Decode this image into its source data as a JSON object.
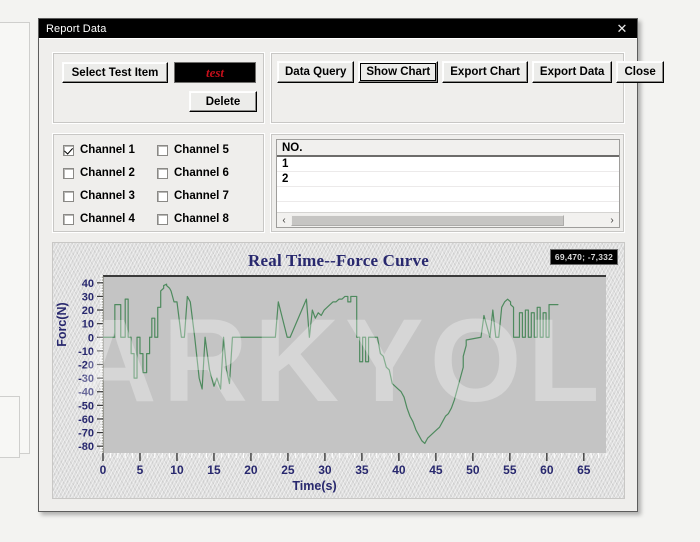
{
  "window": {
    "title": "Report Data",
    "close_icon": "close-icon",
    "close_glyph": "✕"
  },
  "test_item": {
    "select_button_label": "Select Test Item",
    "test_name_value": "test",
    "delete_button_label": "Delete"
  },
  "actions": {
    "buttons": [
      {
        "label": "Data Query",
        "focused": false
      },
      {
        "label": "Show Chart",
        "focused": true
      },
      {
        "label": "Export Chart",
        "focused": false
      },
      {
        "label": "Export Data",
        "focused": false
      },
      {
        "label": "Close",
        "focused": false
      }
    ]
  },
  "channels": [
    {
      "label": "Channel 1",
      "checked": true
    },
    {
      "label": "Channel 2",
      "checked": false
    },
    {
      "label": "Channel 3",
      "checked": false
    },
    {
      "label": "Channel 4",
      "checked": false
    },
    {
      "label": "Channel 5",
      "checked": false
    },
    {
      "label": "Channel 6",
      "checked": false
    },
    {
      "label": "Channel 7",
      "checked": false
    },
    {
      "label": "Channel 8",
      "checked": false
    }
  ],
  "record_list": {
    "header": "NO.",
    "rows": [
      "1",
      "2"
    ],
    "empty_rows": 4,
    "scroll_left_glyph": "‹",
    "scroll_right_glyph": "›"
  },
  "chart_panel": {
    "coord_readout": "69,470; -7,332",
    "watermark": "ARKYOL"
  },
  "chart_data": {
    "type": "line",
    "title": "Real Time--Force Curve",
    "xlabel": "Time(s)",
    "ylabel": "Forc(N)",
    "xlim": [
      0,
      68
    ],
    "ylim": [
      -85,
      45
    ],
    "xticks": [
      0,
      5,
      10,
      15,
      20,
      25,
      30,
      35,
      40,
      45,
      50,
      55,
      60,
      65
    ],
    "yticks": [
      40,
      30,
      20,
      10,
      0,
      -10,
      -20,
      -30,
      -40,
      -50,
      -60,
      -70,
      -80
    ],
    "grid": false,
    "legend": false,
    "line_color": "#4e8a5e",
    "plot_bg": "#c4c4c4",
    "series": [
      {
        "name": "Channel 1",
        "x": [
          0.0,
          1.6,
          1.6,
          2.4,
          2.4,
          3.0,
          3.0,
          3.4,
          3.4,
          3.8,
          3.8,
          4.2,
          4.2,
          4.6,
          4.6,
          5.0,
          5.0,
          5.4,
          5.4,
          5.9,
          5.9,
          6.3,
          6.3,
          6.6,
          6.6,
          7.0,
          7.0,
          7.4,
          7.4,
          7.8,
          7.8,
          8.2,
          8.2,
          8.6,
          8.6,
          9.0,
          9.2,
          9.6,
          10.0,
          10.6,
          11.0,
          11.4,
          11.4,
          11.8,
          11.8,
          12.4,
          12.4,
          13.0,
          13.0,
          13.4,
          13.4,
          13.8,
          13.8,
          14.4,
          14.4,
          15.0,
          15.0,
          15.4,
          15.4,
          15.9,
          15.9,
          16.3,
          16.3,
          16.7,
          16.7,
          17.1,
          17.1,
          17.5,
          17.5,
          17.9,
          17.9,
          18.3,
          18.3,
          18.7,
          18.7,
          19.1,
          19.1,
          19.5,
          19.5,
          19.9,
          19.9,
          20.3,
          20.3,
          20.7,
          20.7,
          21.1,
          21.1,
          23.3,
          23.3,
          23.7,
          23.7,
          24.9,
          24.9,
          25.3,
          25.3,
          27.5,
          27.5,
          27.9,
          27.9,
          28.3,
          28.3,
          28.7,
          29.1,
          29.5,
          29.9,
          30.3,
          30.7,
          31.1,
          31.5,
          31.9,
          32.3,
          32.7,
          33.1,
          33.1,
          33.5,
          33.5,
          34.3,
          34.3,
          34.7,
          34.7,
          35.1,
          35.1,
          35.5,
          35.5,
          35.9,
          35.9,
          36.3,
          36.3,
          37.1,
          37.5,
          37.9,
          38.3,
          38.7,
          39.1,
          39.5,
          39.9,
          40.3,
          40.7,
          41.1,
          41.5,
          41.9,
          42.3,
          42.7,
          43.1,
          43.5,
          43.9,
          44.3,
          44.7,
          45.1,
          45.5,
          45.9,
          46.3,
          46.7,
          47.1,
          47.5,
          47.9,
          48.3,
          48.7,
          48.7,
          49.1,
          49.1,
          51.1,
          51.1,
          51.5,
          51.5,
          52.3,
          52.3,
          52.7,
          52.7,
          53.1,
          53.5,
          53.9,
          54.3,
          54.7,
          55.1,
          55.1,
          55.5,
          55.5,
          56.3,
          56.3,
          56.7,
          56.7,
          57.1,
          57.1,
          57.5,
          57.5,
          57.9,
          57.9,
          58.3,
          58.3,
          58.7,
          58.7,
          59.1,
          59.1,
          59.5,
          59.5,
          59.9,
          59.9,
          60.3,
          60.3,
          61.5
        ],
        "y": [
          0,
          0,
          24,
          24,
          0,
          0,
          28,
          28,
          0,
          0,
          -12,
          -12,
          -30,
          -30,
          0,
          0,
          -12,
          -12,
          -26,
          -26,
          -12,
          -12,
          0,
          0,
          14,
          14,
          0,
          0,
          22,
          22,
          34,
          36,
          38,
          39,
          38,
          36,
          34,
          26,
          26,
          0,
          0,
          30,
          30,
          26,
          26,
          0,
          0,
          -30,
          -30,
          -38,
          -38,
          0,
          0,
          -24,
          -24,
          -36,
          -36,
          -30,
          -30,
          -38,
          -38,
          0,
          0,
          -24,
          -24,
          -34,
          -34,
          0,
          0,
          0,
          0,
          0,
          0,
          0,
          0,
          0,
          0,
          0,
          0,
          0,
          0,
          0,
          0,
          0,
          0,
          0,
          0,
          0,
          0,
          26,
          26,
          0,
          0,
          0,
          0,
          28,
          28,
          0,
          0,
          20,
          20,
          14,
          18,
          16,
          20,
          22,
          24,
          26,
          26,
          28,
          28,
          30,
          30,
          26,
          26,
          30,
          30,
          0,
          0,
          -18,
          -18,
          0,
          0,
          -18,
          -18,
          0,
          0,
          0,
          0,
          -12,
          -14,
          -22,
          -24,
          -34,
          -36,
          -38,
          -40,
          -44,
          -52,
          -58,
          -62,
          -68,
          -72,
          -76,
          -78,
          -74,
          -72,
          -70,
          -68,
          -66,
          -62,
          -58,
          -56,
          -52,
          -46,
          -38,
          -30,
          -22,
          -14,
          -6,
          -2,
          0,
          0,
          16,
          16,
          0,
          0,
          20,
          20,
          0,
          0,
          22,
          26,
          28,
          26,
          24,
          22,
          0,
          0,
          18,
          18,
          0,
          0,
          20,
          20,
          0,
          0,
          18,
          18,
          0,
          0,
          22,
          22,
          0,
          0,
          18,
          18,
          0,
          0,
          24,
          24,
          0,
          0
        ]
      }
    ]
  }
}
